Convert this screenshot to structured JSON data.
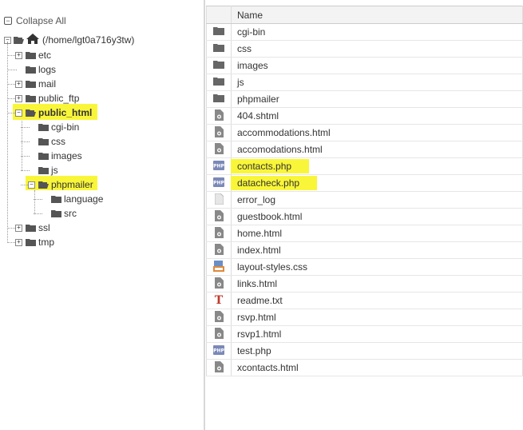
{
  "tree": {
    "collapse_all": "Collapse All",
    "root_label": "(/home/lgt0a716y3tw)",
    "nodes": [
      {
        "label": "etc",
        "level": 1,
        "toggle": "+"
      },
      {
        "label": "logs",
        "level": 1,
        "toggle": ""
      },
      {
        "label": "mail",
        "level": 1,
        "toggle": "+"
      },
      {
        "label": "public_ftp",
        "level": 1,
        "toggle": "+"
      },
      {
        "label": "public_html",
        "level": 1,
        "toggle": "-",
        "bold": true,
        "highlight": true
      },
      {
        "label": "cgi-bin",
        "level": 2,
        "toggle": ""
      },
      {
        "label": "css",
        "level": 2,
        "toggle": ""
      },
      {
        "label": "images",
        "level": 2,
        "toggle": ""
      },
      {
        "label": "js",
        "level": 2,
        "toggle": ""
      },
      {
        "label": "phpmailer",
        "level": 2,
        "toggle": "-",
        "highlight": true
      },
      {
        "label": "language",
        "level": 3,
        "toggle": ""
      },
      {
        "label": "src",
        "level": 3,
        "toggle": ""
      },
      {
        "label": "ssl",
        "level": 1,
        "toggle": "+"
      },
      {
        "label": "tmp",
        "level": 1,
        "toggle": "+"
      }
    ]
  },
  "files": {
    "header_name": "Name",
    "rows": [
      {
        "name": "cgi-bin",
        "icon": "folder-icon"
      },
      {
        "name": "css",
        "icon": "folder-icon"
      },
      {
        "name": "images",
        "icon": "folder-icon"
      },
      {
        "name": "js",
        "icon": "folder-icon"
      },
      {
        "name": "phpmailer",
        "icon": "folder-icon"
      },
      {
        "name": "404.shtml",
        "icon": "html-file-icon"
      },
      {
        "name": "accommodations.html",
        "icon": "html-file-icon"
      },
      {
        "name": "accomodations.html",
        "icon": "html-file-icon"
      },
      {
        "name": "contacts.php",
        "icon": "php-file-icon",
        "highlight": true
      },
      {
        "name": "datacheck.php",
        "icon": "php-file-icon",
        "highlight": true
      },
      {
        "name": "error_log",
        "icon": "text-file-icon"
      },
      {
        "name": "guestbook.html",
        "icon": "html-file-icon"
      },
      {
        "name": "home.html",
        "icon": "html-file-icon"
      },
      {
        "name": "index.html",
        "icon": "html-file-icon"
      },
      {
        "name": "layout-styles.css",
        "icon": "css-file-icon"
      },
      {
        "name": "links.html",
        "icon": "html-file-icon"
      },
      {
        "name": "readme.txt",
        "icon": "txt-file-icon"
      },
      {
        "name": "rsvp.html",
        "icon": "html-file-icon"
      },
      {
        "name": "rsvp1.html",
        "icon": "html-file-icon"
      },
      {
        "name": "test.php",
        "icon": "php-file-icon"
      },
      {
        "name": "xcontacts.html",
        "icon": "html-file-icon"
      }
    ]
  },
  "colors": {
    "highlight": "#f9f63a",
    "folder": "#555555",
    "header_bg": "#f3f3f3"
  }
}
